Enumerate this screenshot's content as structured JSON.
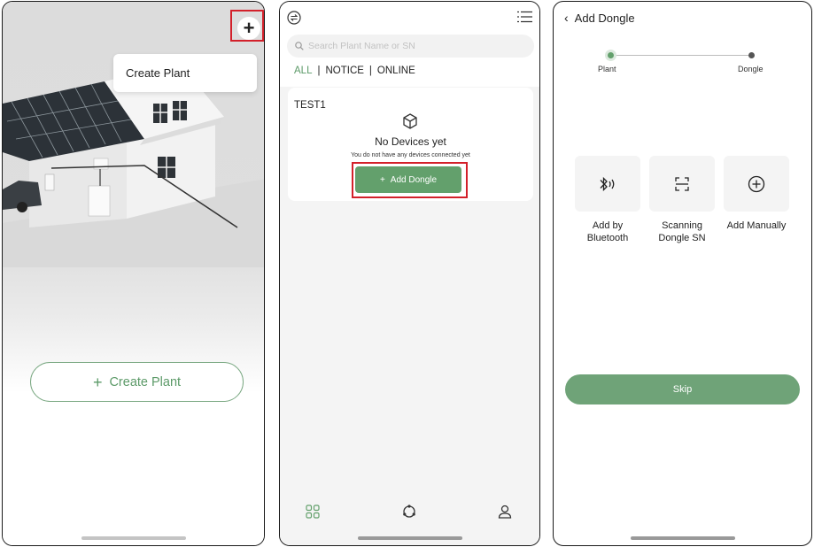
{
  "colors": {
    "accent": "#63a06c",
    "highlight": "#d3202a",
    "frame": "#1a1a1a"
  },
  "screen1": {
    "plus_icon": "plus-icon",
    "menu_item": "Create Plant",
    "create_button": {
      "icon": "plus-icon",
      "label": "Create Plant"
    }
  },
  "screen2": {
    "top_left_icon": "sync-icon",
    "top_right_icon": "list-icon",
    "search": {
      "icon": "search-icon",
      "placeholder": "Search Plant Name or SN"
    },
    "tabs": [
      {
        "label": "ALL",
        "active": true
      },
      {
        "label": "NOTICE",
        "active": false
      },
      {
        "label": "ONLINE",
        "active": false
      }
    ],
    "separator": "|",
    "plant_card": {
      "name": "TEST1",
      "empty_icon": "cube-icon",
      "empty_title": "No Devices yet",
      "empty_subtitle": "You do not have any devices connected yet",
      "button": {
        "icon": "plus-icon",
        "label": "Add Dongle"
      }
    },
    "bottom_nav": [
      {
        "icon": "grid-icon",
        "active": true
      },
      {
        "icon": "cycle-icon",
        "active": false
      },
      {
        "icon": "user-icon",
        "active": false
      }
    ]
  },
  "screen3": {
    "title": "Add Dongle",
    "back_icon": "chevron-left-icon",
    "steps": [
      {
        "label": "Plant",
        "state": "current"
      },
      {
        "label": "Dongle",
        "state": "pending"
      }
    ],
    "options": [
      {
        "icon": "bluetooth-icon",
        "label_line1": "Add by",
        "label_line2": "Bluetooth"
      },
      {
        "icon": "scan-icon",
        "label_line1": "Scanning",
        "label_line2": "Dongle SN"
      },
      {
        "icon": "plus-circle-icon",
        "label_line1": "Add Manually",
        "label_line2": ""
      }
    ],
    "skip_label": "Skip"
  }
}
